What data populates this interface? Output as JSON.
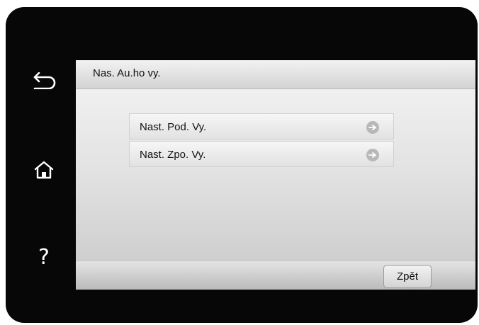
{
  "device": {
    "side_buttons": {
      "back": {
        "icon": "back-arrow-icon"
      },
      "home": {
        "icon": "home-icon"
      },
      "help": {
        "icon": "help-icon",
        "glyph": "?"
      }
    }
  },
  "screen": {
    "title": "Nas. Au.ho vy.",
    "menu": [
      {
        "label": "Nast. Pod. Vy.",
        "icon": "arrow-right-icon"
      },
      {
        "label": "Nast. Zpo. Vy.",
        "icon": "arrow-right-icon"
      }
    ],
    "back_button_label": "Zpět"
  },
  "colors": {
    "bezel": "#070707",
    "screen_bg": "#e3e3e3",
    "arrow_circle": "#b8b8b8"
  }
}
